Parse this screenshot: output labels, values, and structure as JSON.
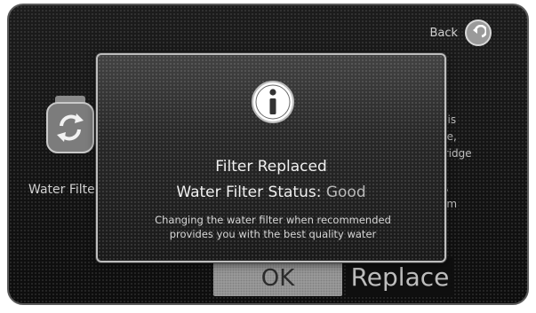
{
  "nav": {
    "back_label": "Back"
  },
  "background": {
    "filter_label": "Water Filter",
    "right_text_fragments": [
      "t is",
      "ge,",
      "tridge",
      "\"",
      "s,",
      "om"
    ]
  },
  "dialog": {
    "title": "Filter Replaced",
    "status_label": "Water Filter Status:",
    "status_value": "Good",
    "message_line1": "Changing the water filter when recommended",
    "message_line2": "provides you with the best quality water"
  },
  "actions": {
    "ok_label": "OK",
    "replace_label": "Replace"
  },
  "icons": {
    "back": "back-arrow-circle-icon",
    "filter": "filter-cartridge-refresh-icon",
    "info": "info-icon"
  }
}
